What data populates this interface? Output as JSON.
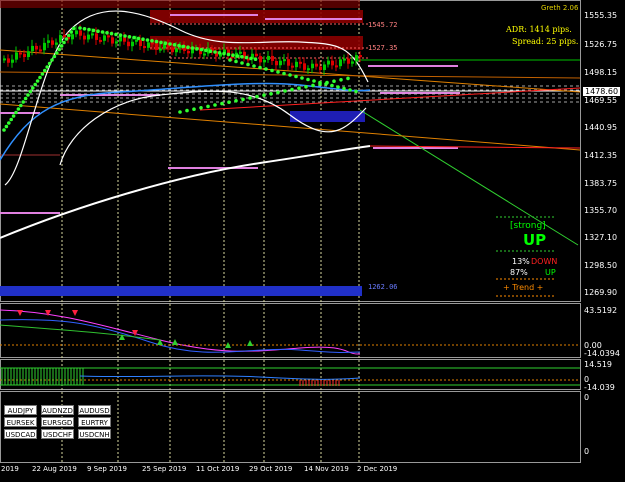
{
  "indicator": {
    "name": "Greth 2.06",
    "adr": "ADR: 1414 pips.",
    "spread": "Spread: 25 pips.",
    "strength": "[strong]",
    "direction": "UP",
    "down_pct": "13%",
    "down_label": "DOWN",
    "up_pct": "87%",
    "up_label": "UP",
    "trend_label": "+   Trend   +"
  },
  "price_axis": [
    "1555.35",
    "1526.75",
    "1498.15",
    "1469.55",
    "1440.95",
    "1412.35",
    "1383.75",
    "1355.70",
    "1327.10",
    "1298.50",
    "1269.90"
  ],
  "current_price": "1478.60",
  "level_tags": [
    "1545.72",
    "1527.35",
    "1262.06"
  ],
  "oscillator_axis": [
    "43.5192",
    "0.00",
    "-14.0394"
  ],
  "sub_axis": [
    "14.519",
    "0",
    "-14.039"
  ],
  "bottom_axis": [
    "0",
    "0"
  ],
  "date_axis": [
    "2019",
    "22 Aug 2019",
    "9 Sep 2019",
    "25 Sep 2019",
    "11 Oct 2019",
    "29 Oct 2019",
    "14 Nov 2019",
    "2 Dec 2019"
  ],
  "pairs": [
    [
      "AUDJPY",
      "AUDNZD",
      "AUDUSD"
    ],
    [
      "EURSEK",
      "EURSGD",
      "EURTRY"
    ],
    [
      "USDCAD",
      "USDCHF",
      "USDCNH"
    ]
  ],
  "colors": {
    "background": "#000000",
    "bull_candle": "#00cc00",
    "bear_candle": "#dd0000",
    "supply_zone": "#8b0000",
    "demand_zone": "#1e1eb4",
    "strong_up": "#00ff00",
    "down": "#ff2020",
    "trend": "#ff8c00"
  }
}
